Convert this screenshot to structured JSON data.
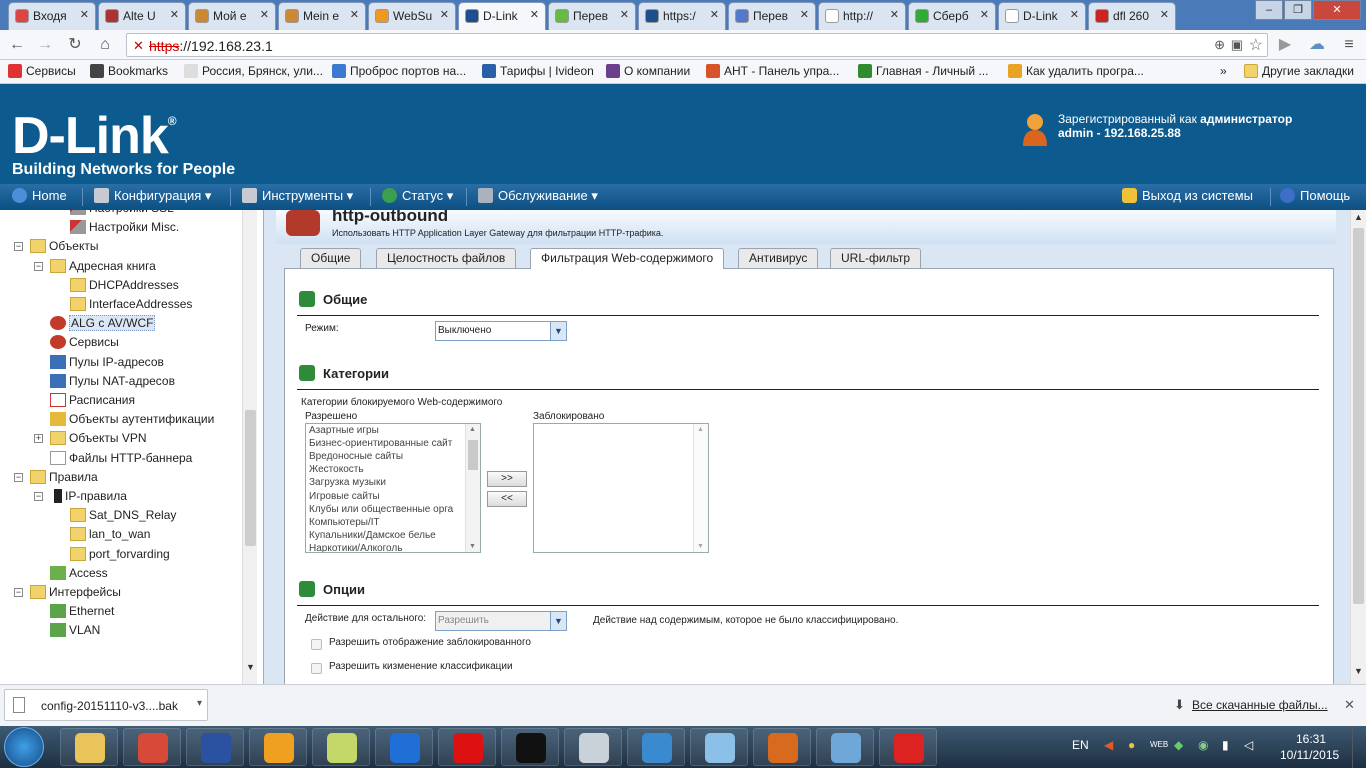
{
  "browser": {
    "tabs": [
      {
        "label": "Входя",
        "color": "#d44"
      },
      {
        "label": "Alte U",
        "color": "#a33"
      },
      {
        "label": "Мой е",
        "color": "#c83"
      },
      {
        "label": "Mein e",
        "color": "#c83"
      },
      {
        "label": "WebSu",
        "color": "#e92"
      },
      {
        "label": "D-Link",
        "color": "#1d4f8f"
      },
      {
        "label": "Перев",
        "color": "#6b4"
      },
      {
        "label": "https:/",
        "color": "#1d4f8f"
      },
      {
        "label": "Перев",
        "color": "#57c"
      },
      {
        "label": "http://",
        "color": "#fff"
      },
      {
        "label": "Сберб",
        "color": "#3a3"
      },
      {
        "label": "D-Link",
        "color": "#fff"
      },
      {
        "label": "dfl 260",
        "color": "#c22"
      }
    ],
    "url_scheme": "https",
    "url_rest": "://192.168.23.1",
    "bookmarks": [
      {
        "label": "Сервисы",
        "color": "#d33"
      },
      {
        "label": "Bookmarks",
        "color": "#444"
      },
      {
        "label": "Россия, Брянск, ули...",
        "color": "#ddd"
      },
      {
        "label": "Проброс портов на...",
        "color": "#3a7ad0"
      },
      {
        "label": "Тарифы | Ivideon",
        "color": "#2a5fa8"
      },
      {
        "label": "О компании",
        "color": "#6a3f8e"
      },
      {
        "label": "АНТ - Панель упра...",
        "color": "#d8532a"
      },
      {
        "label": "Главная - Личный ...",
        "color": "#2e8b2e"
      },
      {
        "label": "Как удалить програ...",
        "color": "#e8a224"
      }
    ],
    "bookmarks_more": "»",
    "other_bookmarks": "Другие закладки"
  },
  "header": {
    "logo_text": "D-Link",
    "logo_reg": "®",
    "logo_sub": "Building Networks for People",
    "user_line1_prefix": "Зарегистрированный как ",
    "user_line1_role": "администратор",
    "user_line2": "admin - 192.168.25.88"
  },
  "menu": {
    "home": "Home",
    "config": "Конфигурация",
    "tools": "Инструменты",
    "status": "Статус",
    "maintenance": "Обслуживание",
    "logout": "Выход из системы",
    "help": "Помощь"
  },
  "tree": [
    {
      "label": "Настройки SSL",
      "indent": 3,
      "icon": "tools"
    },
    {
      "label": "Настройки Misc.",
      "indent": 3,
      "icon": "tools"
    },
    {
      "label": "Объекты",
      "indent": 1,
      "icon": "folder",
      "exp": "−"
    },
    {
      "label": "Адресная книга",
      "indent": 2,
      "icon": "folder",
      "exp": "−"
    },
    {
      "label": "DHCPAddresses",
      "indent": 3,
      "icon": "folder"
    },
    {
      "label": "InterfaceAddresses",
      "indent": 3,
      "icon": "folder"
    },
    {
      "label": "ALG с AV/WCF",
      "indent": 2,
      "icon": "gear",
      "selected": true
    },
    {
      "label": "Сервисы",
      "indent": 2,
      "icon": "gear"
    },
    {
      "label": "Пулы IP-адресов",
      "indent": 2,
      "icon": "net"
    },
    {
      "label": "Пулы NAT-адресов",
      "indent": 2,
      "icon": "net"
    },
    {
      "label": "Расписания",
      "indent": 2,
      "icon": "cal"
    },
    {
      "label": "Объекты аутентификации",
      "indent": 2,
      "icon": "key"
    },
    {
      "label": "Объекты VPN",
      "indent": 2,
      "icon": "folder",
      "exp": "+"
    },
    {
      "label": "Файлы HTTP-баннера",
      "indent": 2,
      "icon": "file"
    },
    {
      "label": "Правила",
      "indent": 1,
      "icon": "folder",
      "exp": "−"
    },
    {
      "label": "IP-правила",
      "indent": 2,
      "icon": "light",
      "exp": "−"
    },
    {
      "label": "Sat_DNS_Relay",
      "indent": 3,
      "icon": "folder"
    },
    {
      "label": "lan_to_wan",
      "indent": 3,
      "icon": "folder"
    },
    {
      "label": "port_forvarding",
      "indent": 3,
      "icon": "folder"
    },
    {
      "label": "Access",
      "indent": 2,
      "icon": "access"
    },
    {
      "label": "Интерфейсы",
      "indent": 1,
      "icon": "folder",
      "exp": "−"
    },
    {
      "label": "Ethernet",
      "indent": 2,
      "icon": "eth"
    },
    {
      "label": "VLAN",
      "indent": 2,
      "icon": "eth"
    }
  ],
  "page": {
    "title": "http-outbound",
    "description": "Использовать HTTP Application Layer Gateway для фильтрации HTTP-трафика.",
    "tabs": [
      "Общие",
      "Целостность файлов",
      "Фильтрация Web-содержимого",
      "Антивирус",
      "URL-фильтр"
    ],
    "active_tab": 2,
    "section_general": "Общие",
    "mode_label": "Режим:",
    "mode_value": "Выключено",
    "section_categories": "Категории",
    "categories_caption": "Категории блокируемого Web-содержимого",
    "allowed_label": "Разрешено",
    "blocked_label": "Заблокировано",
    "allowed_items": [
      "Азартные игры",
      "Бизнес-ориентированные сайт",
      "Вредоносные сайты",
      "Жестокость",
      "Загрузка музыки",
      "Игровые сайты",
      "Клубы или общественные орга",
      "Компьютеры/IT",
      "Купальники/Дамское белье",
      "Наркотики/Алкоголь"
    ],
    "btn_add": ">>",
    "btn_remove": "<<",
    "section_options": "Опции",
    "action_label": "Действие для остального:",
    "action_value": "Разрешить",
    "action_desc": "Действие над содержимым, которое не было классифицировано.",
    "chk1": "Разрешить отображение заблокированного",
    "chk2": "Разрешить кизменение классификации"
  },
  "downloads": {
    "file": "config-20151110-v3....bak",
    "all": "Все скачанные файлы..."
  },
  "taskbar": {
    "lang": "EN",
    "time": "16:31",
    "date": "10/11/2015"
  }
}
